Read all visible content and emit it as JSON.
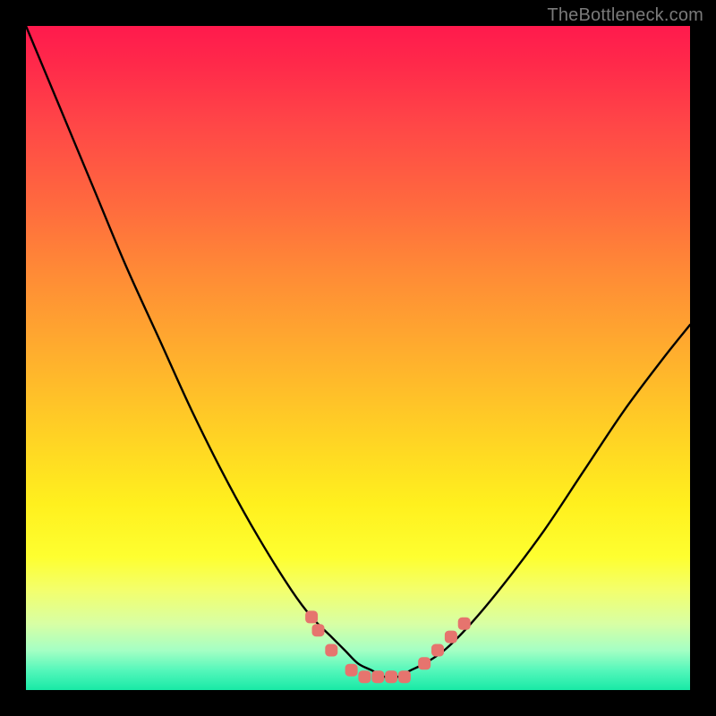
{
  "watermark": "TheBottleneck.com",
  "colors": {
    "curve_stroke": "#000000",
    "marker_fill": "#e6746e",
    "marker_stroke": "#e6746e"
  },
  "chart_data": {
    "type": "line",
    "title": "",
    "xlabel": "",
    "ylabel": "",
    "x": [
      0,
      5,
      10,
      15,
      20,
      25,
      30,
      35,
      40,
      43,
      46,
      48,
      50,
      52,
      54,
      56,
      58,
      60,
      63,
      67,
      72,
      78,
      84,
      90,
      96,
      100
    ],
    "y": [
      100,
      88,
      76,
      64,
      53,
      42,
      32,
      23,
      15,
      11,
      8,
      6,
      4,
      3,
      2,
      2,
      3,
      4,
      6,
      10,
      16,
      24,
      33,
      42,
      50,
      55
    ],
    "xlim": [
      0,
      100
    ],
    "ylim": [
      0,
      100
    ],
    "markers": [
      {
        "x": 43,
        "y": 11
      },
      {
        "x": 44,
        "y": 9
      },
      {
        "x": 46,
        "y": 6
      },
      {
        "x": 49,
        "y": 3
      },
      {
        "x": 51,
        "y": 2
      },
      {
        "x": 53,
        "y": 2
      },
      {
        "x": 55,
        "y": 2
      },
      {
        "x": 57,
        "y": 2
      },
      {
        "x": 60,
        "y": 4
      },
      {
        "x": 62,
        "y": 6
      },
      {
        "x": 64,
        "y": 8
      },
      {
        "x": 66,
        "y": 10
      }
    ]
  }
}
